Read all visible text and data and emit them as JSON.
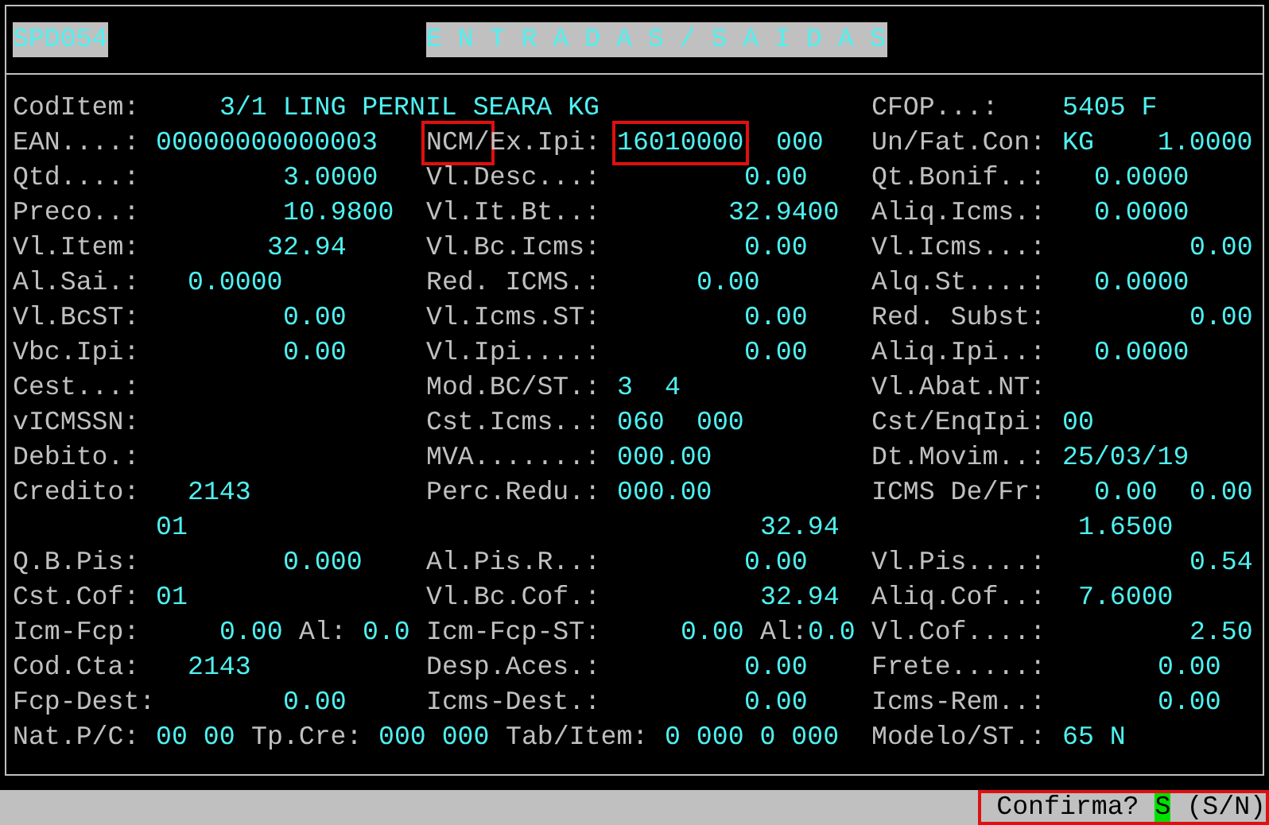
{
  "header": {
    "program_code": "SPD054",
    "title": "E N T R A D A S / S A I D A S"
  },
  "rows": [
    [
      {
        "text": "CodItem:",
        "kind": "label"
      },
      {
        "text": "3/1 LING PERNIL SEARA KG",
        "kind": "value"
      },
      {
        "text": "CFOP...:",
        "kind": "label"
      },
      {
        "text": "5405 F",
        "kind": "value"
      }
    ],
    [
      {
        "text": "EAN....:",
        "kind": "label"
      },
      {
        "text": "00000000000003",
        "kind": "value"
      },
      {
        "text": "NCM/",
        "kind": "label",
        "highlighted": true
      },
      {
        "text": "Ex.Ipi:",
        "kind": "label"
      },
      {
        "text": "16010000",
        "kind": "value",
        "highlighted": true
      },
      {
        "text": "000",
        "kind": "value"
      },
      {
        "text": "Un/Fat.Con:",
        "kind": "label"
      },
      {
        "text": "KG",
        "kind": "value"
      },
      {
        "text": "1.0000",
        "kind": "value"
      }
    ],
    [
      {
        "text": "Qtd....:",
        "kind": "label"
      },
      {
        "text": "3.0000",
        "kind": "value"
      },
      {
        "text": "Vl.Desc...:",
        "kind": "label"
      },
      {
        "text": "0.00",
        "kind": "value"
      },
      {
        "text": "Qt.Bonif..:",
        "kind": "label"
      },
      {
        "text": "0.0000",
        "kind": "value"
      }
    ],
    [
      {
        "text": "Preco..:",
        "kind": "label"
      },
      {
        "text": "10.9800",
        "kind": "value"
      },
      {
        "text": "Vl.It.Bt..:",
        "kind": "label"
      },
      {
        "text": "32.9400",
        "kind": "value"
      },
      {
        "text": "Aliq.Icms.:",
        "kind": "label"
      },
      {
        "text": "0.0000",
        "kind": "value"
      }
    ],
    [
      {
        "text": "Vl.Item:",
        "kind": "label"
      },
      {
        "text": "32.94",
        "kind": "value"
      },
      {
        "text": "Vl.Bc.Icms:",
        "kind": "label"
      },
      {
        "text": "0.00",
        "kind": "value"
      },
      {
        "text": "Vl.Icms...:",
        "kind": "label"
      },
      {
        "text": "0.00",
        "kind": "value"
      }
    ],
    [
      {
        "text": "Al.Sai.:",
        "kind": "label"
      },
      {
        "text": "0.0000",
        "kind": "value"
      },
      {
        "text": "Red. ICMS.:",
        "kind": "label"
      },
      {
        "text": "0.00",
        "kind": "value"
      },
      {
        "text": "Alq.St....:",
        "kind": "label"
      },
      {
        "text": "0.0000",
        "kind": "value"
      }
    ],
    [
      {
        "text": "Vl.BcST:",
        "kind": "label"
      },
      {
        "text": "0.00",
        "kind": "value"
      },
      {
        "text": "Vl.Icms.ST:",
        "kind": "label"
      },
      {
        "text": "0.00",
        "kind": "value"
      },
      {
        "text": "Red. Subst:",
        "kind": "label"
      },
      {
        "text": "0.00",
        "kind": "value"
      }
    ],
    [
      {
        "text": "Vbc.Ipi:",
        "kind": "label"
      },
      {
        "text": "0.00",
        "kind": "value"
      },
      {
        "text": "Vl.Ipi....:",
        "kind": "label"
      },
      {
        "text": "0.00",
        "kind": "value"
      },
      {
        "text": "Aliq.Ipi..:",
        "kind": "label"
      },
      {
        "text": "0.0000",
        "kind": "value"
      }
    ],
    [
      {
        "text": "Cest...:",
        "kind": "label"
      },
      {
        "text": "Mod.BC/ST.:",
        "kind": "label"
      },
      {
        "text": "3",
        "kind": "value"
      },
      {
        "text": "4",
        "kind": "value"
      },
      {
        "text": "Vl.Abat.NT:",
        "kind": "label"
      }
    ],
    [
      {
        "text": "vICMSSN:",
        "kind": "label"
      },
      {
        "text": "Cst.Icms..:",
        "kind": "label"
      },
      {
        "text": "060",
        "kind": "value"
      },
      {
        "text": "000",
        "kind": "value"
      },
      {
        "text": "Cst/EnqIpi:",
        "kind": "label"
      },
      {
        "text": "00",
        "kind": "value"
      }
    ],
    [
      {
        "text": "Debito.:",
        "kind": "label"
      },
      {
        "text": "MVA.......:",
        "kind": "label"
      },
      {
        "text": "000.00",
        "kind": "value"
      },
      {
        "text": "Dt.Movim..:",
        "kind": "label"
      },
      {
        "text": "25/03/19",
        "kind": "value"
      }
    ],
    [
      {
        "text": "Credito:",
        "kind": "label"
      },
      {
        "text": "2143",
        "kind": "value"
      },
      {
        "text": "Perc.Redu.:",
        "kind": "label"
      },
      {
        "text": "000.00",
        "kind": "value"
      },
      {
        "text": "ICMS De/Fr:",
        "kind": "label"
      },
      {
        "text": "0.00",
        "kind": "value"
      },
      {
        "text": "0.00",
        "kind": "value"
      }
    ],
    [
      {
        "text": "01",
        "kind": "value"
      },
      {
        "text": "32.94",
        "kind": "value"
      },
      {
        "text": "1.6500",
        "kind": "value"
      }
    ],
    [
      {
        "text": "Q.B.Pis:",
        "kind": "label"
      },
      {
        "text": "0.000",
        "kind": "value"
      },
      {
        "text": "Al.Pis.R..:",
        "kind": "label"
      },
      {
        "text": "0.00",
        "kind": "value"
      },
      {
        "text": "Vl.Pis....:",
        "kind": "label"
      },
      {
        "text": "0.54",
        "kind": "value"
      }
    ],
    [
      {
        "text": "Cst.Cof:",
        "kind": "label"
      },
      {
        "text": "01",
        "kind": "value"
      },
      {
        "text": "Vl.Bc.Cof.:",
        "kind": "label"
      },
      {
        "text": "32.94",
        "kind": "value"
      },
      {
        "text": "Aliq.Cof..:",
        "kind": "label"
      },
      {
        "text": "7.6000",
        "kind": "value"
      }
    ],
    [
      {
        "text": "Icm-Fcp:",
        "kind": "label"
      },
      {
        "text": "0.00",
        "kind": "value"
      },
      {
        "text": "Al:",
        "kind": "label"
      },
      {
        "text": "0.0",
        "kind": "value"
      },
      {
        "text": "Icm-Fcp-ST:",
        "kind": "label"
      },
      {
        "text": "0.00",
        "kind": "value"
      },
      {
        "text": "Al:",
        "kind": "label"
      },
      {
        "text": "0.0",
        "kind": "value"
      },
      {
        "text": "Vl.Cof....:",
        "kind": "label"
      },
      {
        "text": "2.50",
        "kind": "value"
      }
    ],
    [
      {
        "text": "Cod.Cta:",
        "kind": "label"
      },
      {
        "text": "2143",
        "kind": "value"
      },
      {
        "text": "Desp.Aces.:",
        "kind": "label"
      },
      {
        "text": "0.00",
        "kind": "value"
      },
      {
        "text": "Frete.....:",
        "kind": "label"
      },
      {
        "text": "0.00",
        "kind": "value"
      }
    ],
    [
      {
        "text": "Fcp-Dest:",
        "kind": "label"
      },
      {
        "text": "0.00",
        "kind": "value"
      },
      {
        "text": "Icms-Dest.:",
        "kind": "label"
      },
      {
        "text": "0.00",
        "kind": "value"
      },
      {
        "text": "Icms-Rem..:",
        "kind": "label"
      },
      {
        "text": "0.00",
        "kind": "value"
      }
    ],
    [
      {
        "text": "Nat.P/C:",
        "kind": "label"
      },
      {
        "text": "00 00",
        "kind": "value"
      },
      {
        "text": "Tp.Cre:",
        "kind": "label"
      },
      {
        "text": "000 000",
        "kind": "value"
      },
      {
        "text": "Tab/Item:",
        "kind": "label"
      },
      {
        "text": "0 000 0 000",
        "kind": "value"
      },
      {
        "text": "Modelo/ST.:",
        "kind": "label"
      },
      {
        "text": "65 N",
        "kind": "value"
      }
    ]
  ],
  "status_bar": {
    "prompt": "Confirma?",
    "answer": "S",
    "options": "(S/N)",
    "highlighted": true
  }
}
